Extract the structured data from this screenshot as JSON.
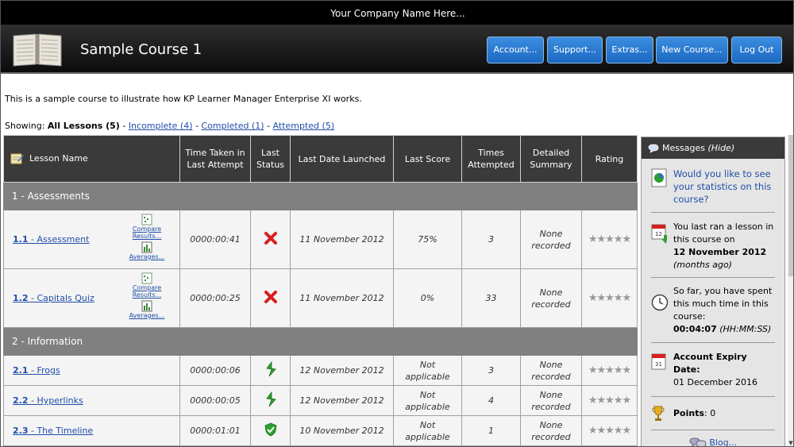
{
  "company": "Your Company Name Here...",
  "header": {
    "course_title": "Sample Course 1",
    "buttons": {
      "account": "Account...",
      "support": "Support...",
      "extras": "Extras...",
      "new_course": "New Course...",
      "logout": "Log Out"
    }
  },
  "description": "This is a sample course to illustrate how KP Learner Manager Enterprise XI works.",
  "filter": {
    "prefix": "Showing:",
    "all": "All Lessons (5)",
    "sep": "-",
    "incomplete": "Incomplete (4)",
    "completed": "Completed (1)",
    "attempted": "Attempted (5)"
  },
  "table": {
    "headers": {
      "name": "Lesson Name",
      "time": "Time Taken in Last Attempt",
      "status": "Last Status",
      "date": "Last Date Launched",
      "score": "Last Score",
      "times": "Times Attempted",
      "summary": "Detailed Summary",
      "rating": "Rating"
    },
    "tools": {
      "compare": "Compare Results...",
      "averages": "Averages..."
    },
    "sections": [
      {
        "title": "1 - Assessments",
        "lessons": [
          {
            "num": "1.1",
            "name": " - Assessment",
            "time": "0000:00:41",
            "status": "failed",
            "date": "11 November 2012",
            "score": "75%",
            "times": "3",
            "summary": [
              "None",
              "recorded"
            ],
            "rating": "★★★★★"
          },
          {
            "num": "1.2",
            "name": " - Capitals Quiz",
            "time": "0000:00:25",
            "status": "failed",
            "date": "11 November 2012",
            "score": "0%",
            "times": "33",
            "summary": [
              "None",
              "recorded"
            ],
            "rating": "★★★★★"
          }
        ]
      },
      {
        "title": "2 - Information",
        "lessons": [
          {
            "num": "2.1",
            "name": " - Frogs",
            "time": "0000:00:06",
            "status": "incomplete",
            "date": "12 November 2012",
            "score": [
              "Not",
              "applicable"
            ],
            "times": "3",
            "summary": [
              "None",
              "recorded"
            ],
            "rating": "★★★★★"
          },
          {
            "num": "2.2",
            "name": " - Hyperlinks",
            "time": "0000:00:05",
            "status": "incomplete",
            "date": "12 November 2012",
            "score": [
              "Not",
              "applicable"
            ],
            "times": "4",
            "summary": [
              "None",
              "recorded"
            ],
            "rating": "★★★★★"
          },
          {
            "num": "2.3",
            "name": " - The Timeline",
            "time": "0000:01:01",
            "status": "completed",
            "date": "10 November 2012",
            "score": [
              "Not",
              "applicable"
            ],
            "times": "1",
            "summary": [
              "None",
              "recorded"
            ],
            "rating": "★★★★★"
          }
        ]
      }
    ]
  },
  "messages": {
    "title": "Messages",
    "hide": "(Hide)",
    "stats_link": "Would you like to see your statistics on this course?",
    "last_ran_text": "You last ran a lesson in this course on",
    "last_ran_date": "12 November 2012",
    "last_ran_ago": "(months ago)",
    "time_spent_text": "So far, you have spent this much time in this course:",
    "time_spent_value": "00:04:07",
    "time_spent_unit": "(HH:MM:SS)",
    "expiry_label": "Account Expiry Date:",
    "expiry_date": "01 December 2016",
    "points_label": "Points",
    "points_value": ": 0",
    "blog": "Blog..."
  },
  "colors": {
    "button": "#2a7bd4",
    "link": "#1f4ea8",
    "failed": "#d62020",
    "passed": "#2e9e2e"
  }
}
